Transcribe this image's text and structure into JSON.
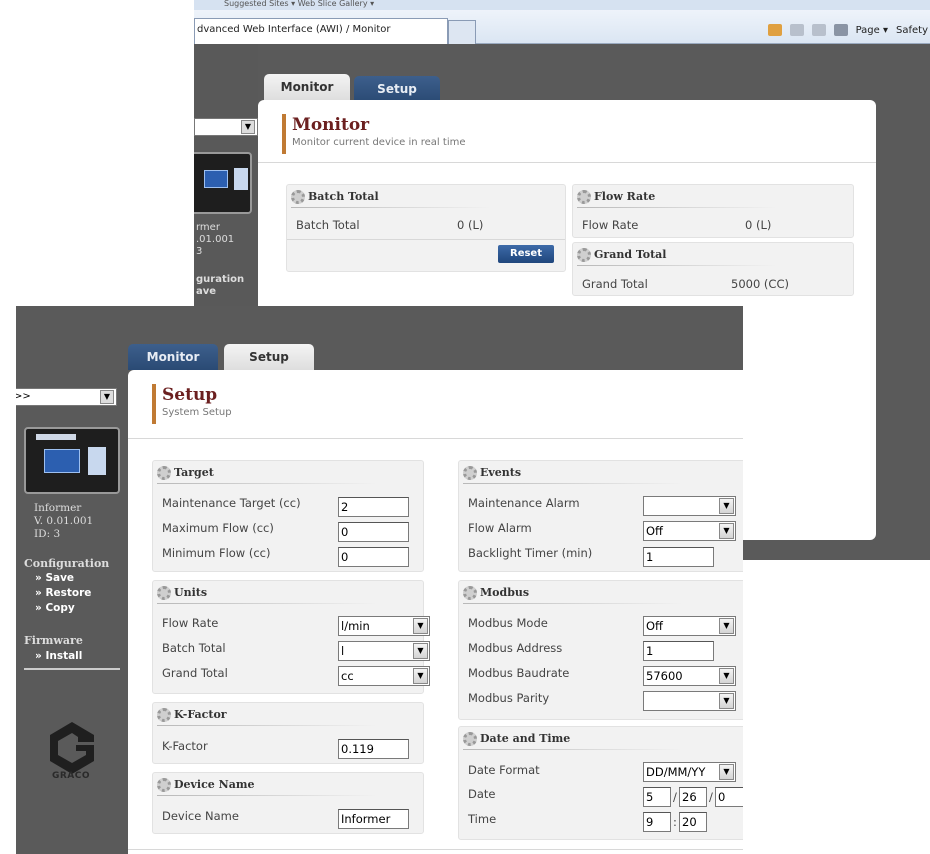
{
  "browser": {
    "top_strip_text": "Suggested Sites ▾   Web Slice Gallery ▾",
    "tab_title": "dvanced Web Interface (AWI) / Monitor",
    "commands": {
      "page": "Page ▾",
      "safety": "Safety"
    }
  },
  "monitor_window": {
    "tabs": [
      {
        "label": "Monitor",
        "active": true
      },
      {
        "label": "Setup",
        "active": false
      }
    ],
    "page_title": "Monitor",
    "page_subtitle": "Monitor current device in real time",
    "sidebar": {
      "device_lines": [
        "rmer",
        ".01.001",
        "3"
      ],
      "config_lines": [
        "guration",
        "ave"
      ]
    },
    "batch_total": {
      "heading": "Batch Total",
      "label": "Batch Total",
      "value": "0 (L)",
      "reset_label": "Reset"
    },
    "flow_rate": {
      "heading": "Flow Rate",
      "label": "Flow Rate",
      "value": "0 (L)"
    },
    "grand_total": {
      "heading": "Grand Total",
      "label": "Grand Total",
      "value": "5000 (CC)"
    }
  },
  "setup_window": {
    "tabs": [
      {
        "label": "Monitor",
        "active": false
      },
      {
        "label": "Setup",
        "active": true
      }
    ],
    "page_title": "Setup",
    "page_subtitle": "System Setup",
    "sidebar": {
      "select_value": ">>",
      "device_name": "Informer",
      "device_version": "V. 0.01.001",
      "device_id": "ID: 3",
      "configuration_heading": "Configuration",
      "configuration_items": [
        "» Save",
        "» Restore",
        "» Copy"
      ],
      "firmware_heading": "Firmware",
      "firmware_items": [
        "» Install"
      ],
      "logo_text": "GRACO"
    },
    "target": {
      "heading": "Target",
      "maintenance_target_label": "Maintenance Target (cc)",
      "maintenance_target_value": "2",
      "maximum_flow_label": "Maximum Flow (cc)",
      "maximum_flow_value": "0",
      "minimum_flow_label": "Minimum Flow (cc)",
      "minimum_flow_value": "0"
    },
    "units": {
      "heading": "Units",
      "flow_rate_label": "Flow Rate",
      "flow_rate_value": "l/min",
      "batch_total_label": "Batch Total",
      "batch_total_value": "l",
      "grand_total_label": "Grand Total",
      "grand_total_value": "cc"
    },
    "k_factor": {
      "heading": "K-Factor",
      "label": "K-Factor",
      "value": "0.119"
    },
    "device_name_box": {
      "heading": "Device Name",
      "label": "Device Name",
      "value": "Informer"
    },
    "events": {
      "heading": "Events",
      "maintenance_alarm_label": "Maintenance Alarm",
      "maintenance_alarm_value": "",
      "flow_alarm_label": "Flow Alarm",
      "flow_alarm_value": "Off",
      "backlight_timer_label": "Backlight Timer (min)",
      "backlight_timer_value": "1"
    },
    "modbus": {
      "heading": "Modbus",
      "mode_label": "Modbus Mode",
      "mode_value": "Off",
      "address_label": "Modbus Address",
      "address_value": "1",
      "baudrate_label": "Modbus Baudrate",
      "baudrate_value": "57600",
      "parity_label": "Modbus Parity",
      "parity_value": ""
    },
    "date_time": {
      "heading": "Date and Time",
      "date_format_label": "Date Format",
      "date_format_value": "DD/MM/YY",
      "date_label": "Date",
      "date_day": "5",
      "date_sep1": "/",
      "date_month": "26",
      "date_sep2": "/",
      "date_year": "0",
      "time_label": "Time",
      "time_hour": "9",
      "time_sep": ":",
      "time_minute": "20"
    }
  },
  "colors": {
    "page_background": "#5a5a5a",
    "title_color": "#6b1f1f",
    "title_accent_bar": "#c07a33",
    "inactive_tab": "#2f5280",
    "button_blue": "#2a5590"
  }
}
